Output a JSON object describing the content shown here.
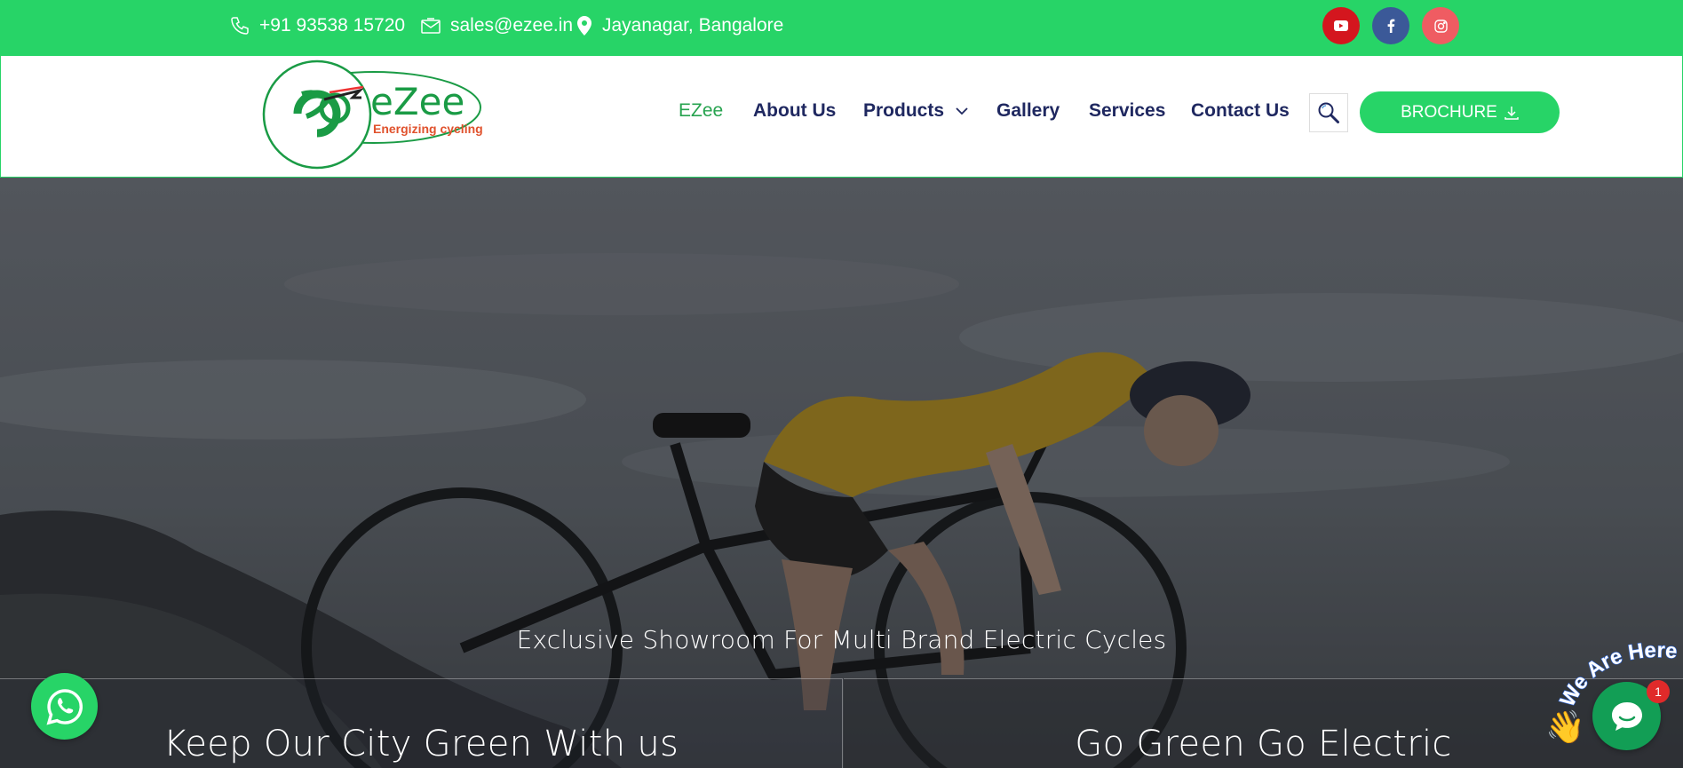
{
  "topbar": {
    "phone": "+91 93538 15720",
    "email": "sales@ezee.in",
    "location": "Jayanagar, Bangalore",
    "social": [
      "youtube-icon",
      "facebook-icon",
      "instagram-icon"
    ]
  },
  "logo": {
    "brand": "eZee",
    "tagline": "Energizing cycling"
  },
  "nav": {
    "items": [
      "EZee",
      "About Us",
      "Products",
      "Gallery",
      "Services",
      "Contact Us"
    ],
    "brochure": "BROCHURE"
  },
  "hero": {
    "tagline": "Exclusive Showroom For Multi Brand Electric Cycles",
    "panel_left": "Keep Our City Green With us",
    "panel_right": "Go Green Go Electric"
  },
  "widgets": {
    "chat_label": "We Are Here!",
    "chat_badge": "1"
  },
  "colors": {
    "accent": "#27d467",
    "nav_text": "#1f2860",
    "nav_active": "#27a34f",
    "youtube": "#d4161e",
    "facebook": "#3b5998",
    "instagram": "#ef5c62"
  }
}
